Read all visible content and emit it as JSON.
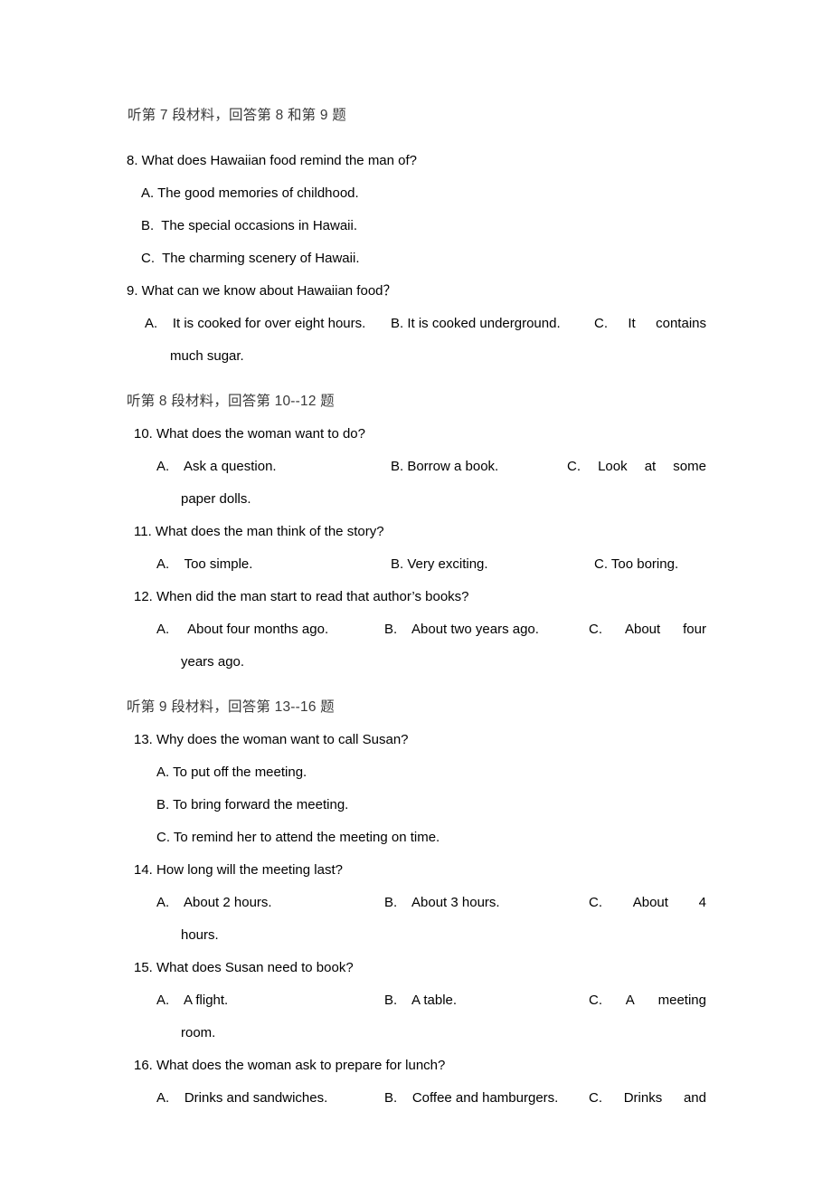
{
  "document": {
    "language": "zh-en",
    "headers": {
      "section7": "听第 7 段材料，回答第 8 和第 9 题",
      "section8": "听第 8 段材料，回答第 10--12 题",
      "section9": "听第 9 段材料，回答第 13--16 题"
    }
  },
  "questions": [
    {
      "number": "8.",
      "stem": "8. What does Hawaiian food remind the man of?",
      "layout": "stacked",
      "options": [
        "A. The good memories of childhood.",
        "B.  The special occasions in Hawaii.",
        "C.  The charming scenery of Hawaii."
      ]
    },
    {
      "number": "9.",
      "stem": "9. What can we know about Hawaiian food？",
      "layout": "three-column",
      "option_a": "A.    It is cooked for over eight hours.",
      "option_b": "B. It is cooked underground.",
      "option_c_label": "C.",
      "option_c_words": [
        "It",
        "contains"
      ],
      "option_c_wrap": "much sugar."
    },
    {
      "number": "10.",
      "stem": "10. What does the woman want to do?",
      "layout": "three-column",
      "option_a": "A.    Ask a question.",
      "option_b": "B. Borrow a book.",
      "option_c_label": "C.",
      "option_c_words": [
        "Look",
        "at",
        "some"
      ],
      "option_c_wrap": "paper dolls."
    },
    {
      "number": "11.",
      "stem": "11. What does the man think of the story?",
      "layout": "three-column-single-line",
      "option_a": "A.    Too simple.",
      "option_b": "B. Very exciting.",
      "option_c": "C. Too boring."
    },
    {
      "number": "12.",
      "stem": "12. When did the man start to read that author’s books?",
      "layout": "three-column",
      "option_a": "A.     About four months ago.",
      "option_b": "B.    About two years ago.",
      "option_c_label": "C.",
      "option_c_words": [
        "About",
        "four"
      ],
      "option_c_wrap": "years ago."
    },
    {
      "number": "13.",
      "stem": "13. Why does the woman want to call Susan?",
      "layout": "stacked",
      "options": [
        "A. To put off the meeting.",
        "B. To bring forward the meeting.",
        "C. To remind her to attend the meeting on time."
      ]
    },
    {
      "number": "14.",
      "stem": "14. How long will the meeting last?",
      "layout": "three-column",
      "option_a": "A.    About 2 hours.",
      "option_b": "B.    About 3 hours.",
      "option_c_label": "C.",
      "option_c_words": [
        "About",
        "4"
      ],
      "option_c_wrap": "hours."
    },
    {
      "number": "15.",
      "stem": "15. What does Susan need to book?",
      "layout": "three-column",
      "option_a": "A.    A flight.",
      "option_b": "B.    A table.",
      "option_c_label": "C.",
      "option_c_words": [
        "A",
        "meeting"
      ],
      "option_c_wrap": "room."
    },
    {
      "number": "16.",
      "stem": "16. What does the woman ask to prepare for lunch?",
      "layout": "three-column-truncated",
      "option_a": "A.    Drinks and sandwiches.",
      "option_b": "B.    Coffee and hamburgers.",
      "option_c_label": "C.",
      "option_c_words": [
        "Drinks",
        "and"
      ]
    }
  ]
}
